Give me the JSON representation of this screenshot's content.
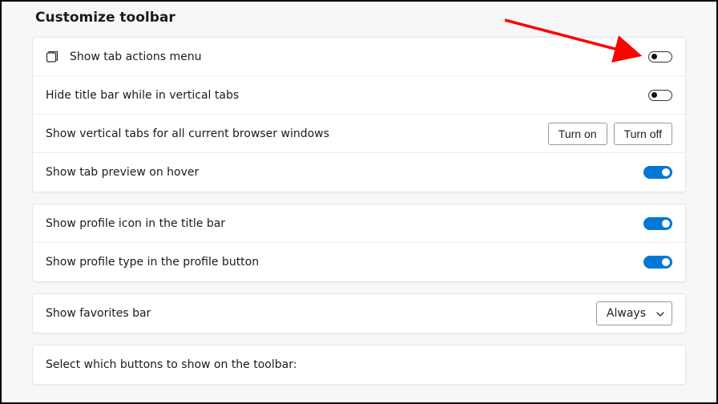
{
  "title": "Customize toolbar",
  "groups": {
    "tabs": {
      "show_tab_actions_menu": {
        "label": "Show tab actions menu",
        "state": "off"
      },
      "hide_title_bar_vertical": {
        "label": "Hide title bar while in vertical tabs",
        "state": "off"
      },
      "show_vertical_tabs_all": {
        "label": "Show vertical tabs for all current browser windows",
        "turn_on": "Turn on",
        "turn_off": "Turn off"
      },
      "show_tab_preview_hover": {
        "label": "Show tab preview on hover",
        "state": "on"
      }
    },
    "profile": {
      "show_profile_icon": {
        "label": "Show profile icon in the title bar",
        "state": "on"
      },
      "show_profile_type": {
        "label": "Show profile type in the profile button",
        "state": "on"
      }
    },
    "favorites": {
      "show_favorites_bar": {
        "label": "Show favorites bar",
        "selected": "Always"
      }
    },
    "buttons": {
      "heading": "Select which buttons to show on the toolbar:"
    }
  }
}
